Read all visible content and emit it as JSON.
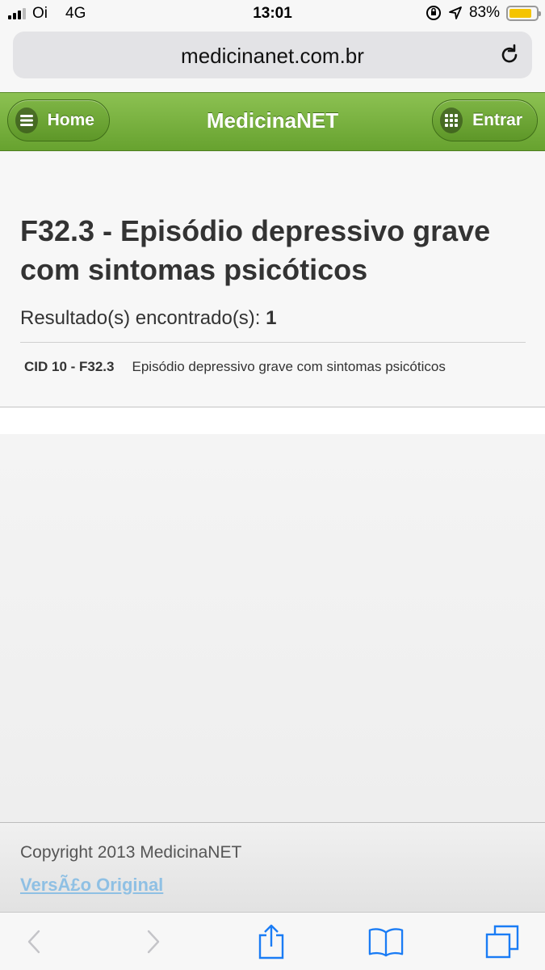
{
  "status_bar": {
    "carrier": "Oi",
    "network": "4G",
    "time": "13:01",
    "battery_percent": "83%",
    "battery_level": 0.83
  },
  "browser": {
    "url": "medicinanet.com.br"
  },
  "header": {
    "home_label": "Home",
    "site_title": "MedicinaNET",
    "login_label": "Entrar",
    "accent_color": "#75ad3a"
  },
  "main": {
    "title": "F32.3 - Episódio depressivo grave com sintomas psicóticos",
    "results_label": "Resultado(s) encontrado(s):",
    "results_count": "1",
    "results": [
      {
        "code": "CID 10 - F32.3",
        "description": "Episódio depressivo grave com sintomas psicóticos"
      }
    ]
  },
  "footer": {
    "copyright": "Copyright 2013 MedicinaNET",
    "original_link": "VersÃ£o Original"
  },
  "toolbar": {
    "icons": [
      "back-icon",
      "forward-icon",
      "share-icon",
      "bookmarks-icon",
      "tabs-icon"
    ]
  }
}
